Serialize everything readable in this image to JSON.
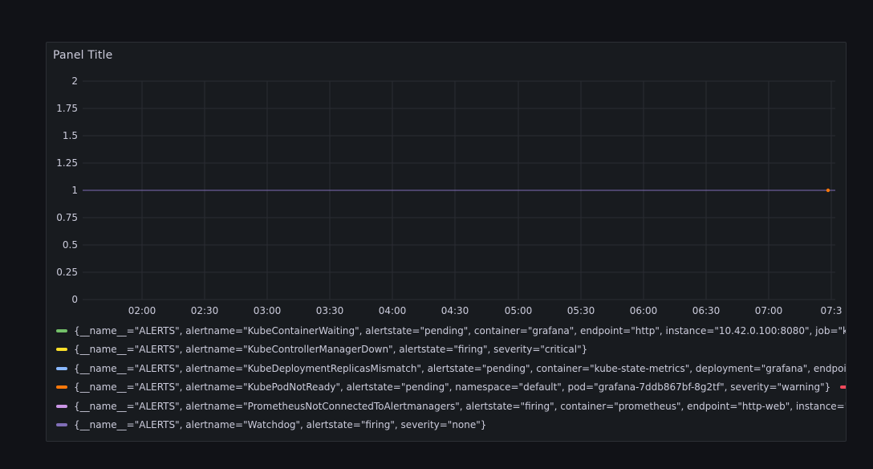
{
  "panel": {
    "title": "Panel Title"
  },
  "chart_data": {
    "type": "line",
    "title": "Panel Title",
    "xlabel": "",
    "ylabel": "",
    "ylim": [
      0,
      2
    ],
    "yticks": [
      "0",
      "0.25",
      "0.5",
      "0.75",
      "1",
      "1.25",
      "1.5",
      "1.75",
      "2"
    ],
    "xticks": [
      "02:00",
      "02:30",
      "03:00",
      "03:30",
      "04:00",
      "04:30",
      "05:00",
      "05:30",
      "06:00",
      "06:30",
      "07:00",
      "07:3"
    ],
    "grid": true,
    "legend_position": "bottom",
    "series": [
      {
        "name": "{__name__=\"ALERTS\", alertname=\"KubeContainerWaiting\", alertstate=\"pending\", container=\"grafana\", endpoint=\"http\", instance=\"10.42.0.100:8080\", job=\"kube-state",
        "color": "#73bf69",
        "values": []
      },
      {
        "name": "{__name__=\"ALERTS\", alertname=\"KubeControllerManagerDown\", alertstate=\"firing\", severity=\"critical\"}",
        "color": "#fade2a",
        "values": [
          1
        ]
      },
      {
        "name": "{__name__=\"ALERTS\", alertname=\"KubeDeploymentReplicasMismatch\", alertstate=\"pending\", container=\"kube-state-metrics\", deployment=\"grafana\", endpoint=\"ht",
        "color": "#8ab8ff",
        "values": []
      },
      {
        "name": "{__name__=\"ALERTS\", alertname=\"KubePodNotReady\", alertstate=\"pending\", namespace=\"default\", pod=\"grafana-7ddb867bf-8g2tf\", severity=\"warning\"}",
        "color": "#ff780a",
        "values": [
          1
        ]
      },
      {
        "name": "{__",
        "color": "#f2495c",
        "values": []
      },
      {
        "name": "{__name__=\"ALERTS\", alertname=\"PrometheusNotConnectedToAlertmanagers\", alertstate=\"firing\", container=\"prometheus\", endpoint=\"http-web\", instance=\"10.42.",
        "color": "#ca95e5",
        "values": [
          1
        ]
      },
      {
        "name": "{__name__=\"ALERTS\", alertname=\"Watchdog\", alertstate=\"firing\", severity=\"none\"}",
        "color": "#806eb7",
        "values": [
          1
        ]
      }
    ]
  }
}
